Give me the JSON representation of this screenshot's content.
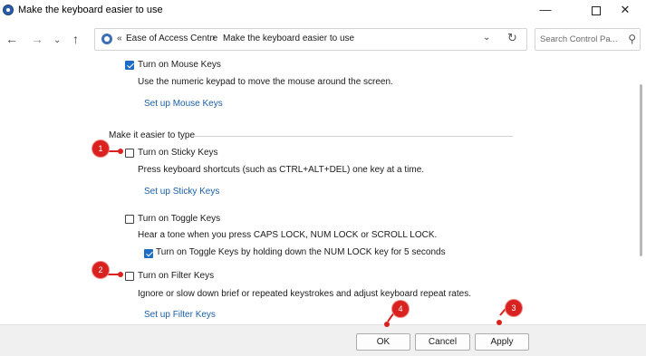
{
  "window": {
    "title": "Make the keyboard easier to use",
    "minimize": "—",
    "close": "✕"
  },
  "nav": {
    "back": "←",
    "forward": "→",
    "recent": "⌄",
    "up": "↑",
    "separator": "«",
    "crumb_arrow": "›",
    "dropdown": "⌄",
    "refresh": "↻",
    "breadcrumbs": [
      "Ease of Access Centre",
      "Make the keyboard easier to use"
    ],
    "search_placeholder": "Search Control Pa...",
    "search_icon": "⚲"
  },
  "mouse_keys": {
    "checkbox_label": "Turn on Mouse Keys",
    "checked": true,
    "description": "Use the numeric keypad to move the mouse around the screen.",
    "link": "Set up Mouse Keys"
  },
  "section": {
    "heading": "Make it easier to type"
  },
  "sticky_keys": {
    "checkbox_label": "Turn on Sticky Keys",
    "checked": false,
    "description": "Press keyboard shortcuts (such as CTRL+ALT+DEL) one key at a time.",
    "link": "Set up Sticky Keys"
  },
  "toggle_keys": {
    "checkbox_label": "Turn on Toggle Keys",
    "checked": false,
    "description": "Hear a tone when you press CAPS LOCK, NUM LOCK or SCROLL LOCK.",
    "sub_option": "Turn on Toggle Keys by holding down the NUM LOCK key for 5 seconds",
    "sub_checked": true
  },
  "filter_keys": {
    "checkbox_label": "Turn on Filter Keys",
    "checked": false,
    "description": "Ignore or slow down brief or repeated keystrokes and adjust keyboard repeat rates.",
    "link": "Set up Filter Keys"
  },
  "markers": [
    "1",
    "2",
    "3",
    "4"
  ],
  "buttons": {
    "ok": "OK",
    "cancel": "Cancel",
    "apply": "Apply"
  },
  "colors": {
    "accent": "#1d6dc7",
    "link": "#1a5fa8",
    "marker": "#d9211f"
  }
}
